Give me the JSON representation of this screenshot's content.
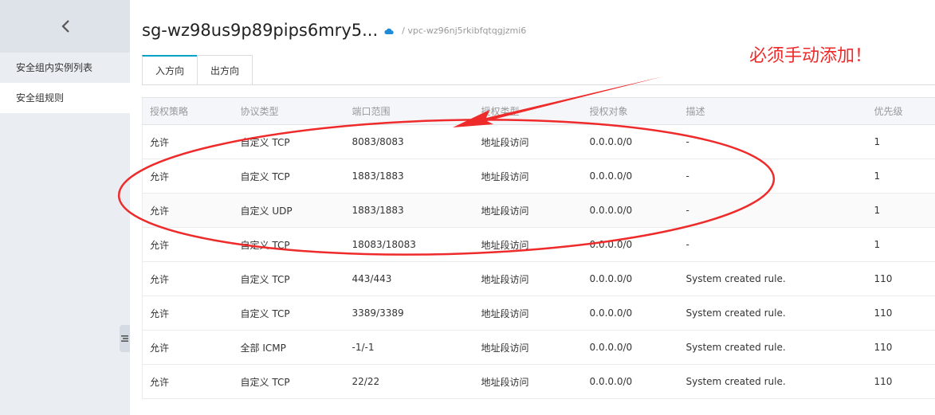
{
  "sidebar": {
    "items": [
      {
        "label": "安全组内实例列表"
      },
      {
        "label": "安全组规则"
      }
    ]
  },
  "header": {
    "title": "sg-wz98us9p89pips6mry5...",
    "vpc": "/ vpc-wz96nj5rkibfqtqgjzmi6"
  },
  "tabs": [
    {
      "label": "入方向"
    },
    {
      "label": "出方向"
    }
  ],
  "table": {
    "columns": [
      "授权策略",
      "协议类型",
      "端口范围",
      "授权类型",
      "授权对象",
      "描述",
      "优先级"
    ],
    "rows": [
      [
        "允许",
        "自定义 TCP",
        "8083/8083",
        "地址段访问",
        "0.0.0.0/0",
        "-",
        "1"
      ],
      [
        "允许",
        "自定义 TCP",
        "1883/1883",
        "地址段访问",
        "0.0.0.0/0",
        "-",
        "1"
      ],
      [
        "允许",
        "自定义 UDP",
        "1883/1883",
        "地址段访问",
        "0.0.0.0/0",
        "-",
        "1"
      ],
      [
        "允许",
        "自定义 TCP",
        "18083/18083",
        "地址段访问",
        "0.0.0.0/0",
        "-",
        "1"
      ],
      [
        "允许",
        "自定义 TCP",
        "443/443",
        "地址段访问",
        "0.0.0.0/0",
        "System created rule.",
        "110"
      ],
      [
        "允许",
        "自定义 TCP",
        "3389/3389",
        "地址段访问",
        "0.0.0.0/0",
        "System created rule.",
        "110"
      ],
      [
        "允许",
        "全部 ICMP",
        "-1/-1",
        "地址段访问",
        "0.0.0.0/0",
        "System created rule.",
        "110"
      ],
      [
        "允许",
        "自定义 TCP",
        "22/22",
        "地址段访问",
        "0.0.0.0/0",
        "System created rule.",
        "110"
      ]
    ]
  },
  "annotation": {
    "note": "必须手动添加！",
    "color": "#ee2a2a"
  },
  "colors": {
    "accent": "#00a2ca",
    "sidebar_bg": "#eaedf1"
  },
  "icons": [
    "chevron-left-icon",
    "cloud-icon",
    "list-icon"
  ]
}
